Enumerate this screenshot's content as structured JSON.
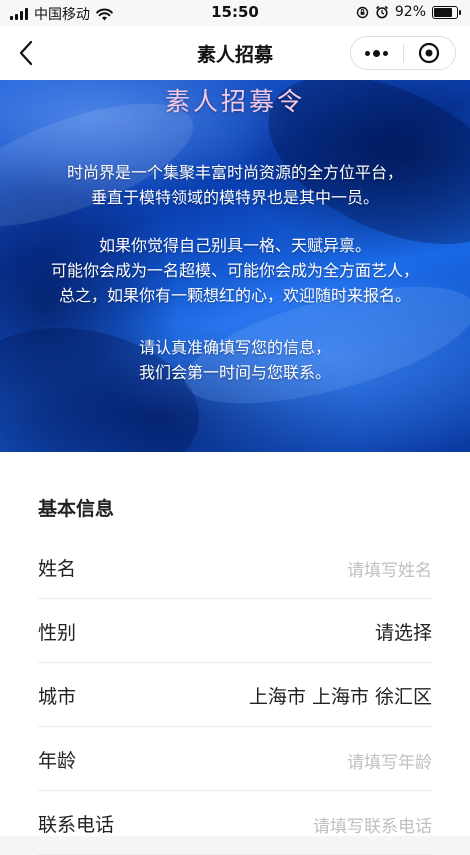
{
  "status_bar": {
    "carrier": "中国移动",
    "time": "15:50",
    "battery": "92%",
    "battery_level": 0.92
  },
  "nav": {
    "title": "素人招募"
  },
  "banner": {
    "title": "素人招募令",
    "paragraphs": [
      [
        "时尚界是一个集聚丰富时尚资源的全方位平台，",
        "垂直于模特领域的模特界也是其中一员。"
      ],
      [
        "如果你觉得自己别具一格、天赋异禀。",
        "可能你会成为一名超模、可能你会成为全方面艺人，",
        "总之，如果你有一颗想红的心，欢迎随时来报名。"
      ],
      [
        "请认真准确填写您的信息，",
        "我们会第一时间与您联系。"
      ]
    ]
  },
  "form": {
    "section_title": "基本信息",
    "fields": {
      "name": {
        "label": "姓名",
        "placeholder": "请填写姓名"
      },
      "gender": {
        "label": "性别",
        "value": "请选择"
      },
      "city": {
        "label": "城市",
        "value": "上海市 上海市 徐汇区"
      },
      "age": {
        "label": "年龄",
        "placeholder": "请填写年龄"
      },
      "phone": {
        "label": "联系电话",
        "placeholder": "请填写联系电话"
      }
    }
  },
  "colors": {
    "banner_blue": "#1a5fd8",
    "banner_title": "#f5c8e6",
    "placeholder": "#c0c0c0"
  }
}
